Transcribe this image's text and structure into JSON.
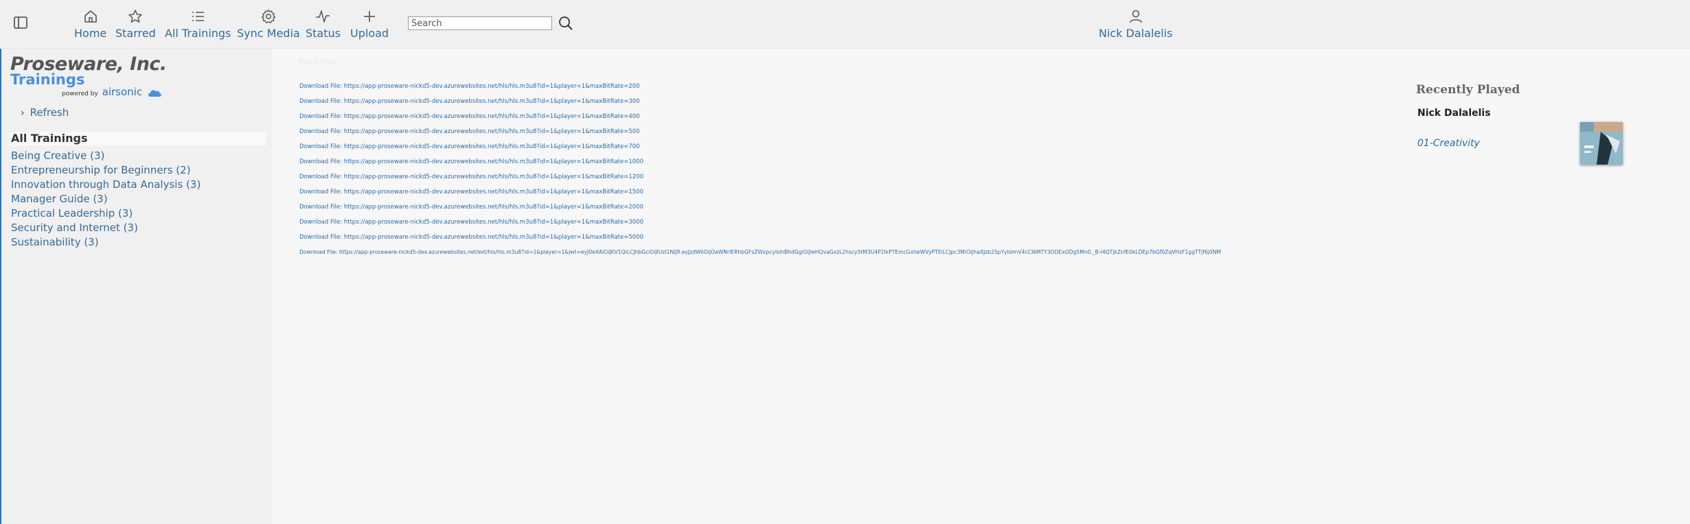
{
  "nav": {
    "items": [
      {
        "label": "Home",
        "icon": "home-icon"
      },
      {
        "label": "Starred",
        "icon": "star-icon"
      },
      {
        "label": "All Trainings",
        "icon": "list-icon"
      },
      {
        "label": "Sync Media",
        "icon": "gear-icon"
      },
      {
        "label": "Status",
        "icon": "pulse-icon"
      },
      {
        "label": "Upload",
        "icon": "plus-icon"
      }
    ],
    "search_placeholder": "Search",
    "user_name": "Nick Dalalelis"
  },
  "sidebar": {
    "logo": {
      "company": "Proseware, Inc.",
      "product": "Trainings",
      "powered_by": "powered by",
      "brand": "airsonic"
    },
    "refresh_label": "Refresh",
    "all_trainings_label": "All Trainings",
    "categories": [
      "Being Creative (3)",
      "Entrepreneurship for Beginners (2)",
      "Innovation through Data Analysis (3)",
      "Manager Guide (3)",
      "Practical Leadership (3)",
      "Security and Internet (3)",
      "Sustainability (3)"
    ]
  },
  "main": {
    "faint_title": "Media Files",
    "downloads": [
      "Download File: https://app-proseware-nickd5-dev.azurewebsites.net/hls/hls.m3u8?id=1&player=1&maxBitRate=200",
      "Download File: https://app-proseware-nickd5-dev.azurewebsites.net/hls/hls.m3u8?id=1&player=1&maxBitRate=300",
      "Download File: https://app-proseware-nickd5-dev.azurewebsites.net/hls/hls.m3u8?id=1&player=1&maxBitRate=400",
      "Download File: https://app-proseware-nickd5-dev.azurewebsites.net/hls/hls.m3u8?id=1&player=1&maxBitRate=500",
      "Download File: https://app-proseware-nickd5-dev.azurewebsites.net/hls/hls.m3u8?id=1&player=1&maxBitRate=700",
      "Download File: https://app-proseware-nickd5-dev.azurewebsites.net/hls/hls.m3u8?id=1&player=1&maxBitRate=1000",
      "Download File: https://app-proseware-nickd5-dev.azurewebsites.net/hls/hls.m3u8?id=1&player=1&maxBitRate=1200",
      "Download File: https://app-proseware-nickd5-dev.azurewebsites.net/hls/hls.m3u8?id=1&player=1&maxBitRate=1500",
      "Download File: https://app-proseware-nickd5-dev.azurewebsites.net/hls/hls.m3u8?id=1&player=1&maxBitRate=2000",
      "Download File: https://app-proseware-nickd5-dev.azurewebsites.net/hls/hls.m3u8?id=1&player=1&maxBitRate=3000",
      "Download File: https://app-proseware-nickd5-dev.azurewebsites.net/hls/hls.m3u8?id=1&player=1&maxBitRate=5000",
      "Download File: https://app-proseware-nickd5-dev.azurewebsites.net/ext/hls/hls.m3u8?id=1&player=1&jwt=eyJ0eXAiOiJKV1QiLCJhbGciOiJIUzI1NiJ9.eyJzdWIiOiJOaWNrIERhbGFsZWxpcyIsInBhdGgiOiJleHQvaGxzL2hscy5tM3U4P2lkPTEmcGxheWVyPTEiLCJpc3MiOiJhaXJzb25pYyIsImV4cCI6MTY3ODExODg5Mn0._B-I4QTjkZnfE0kLDEp7bGf0ZqVHzF1ggTTjf6j0NM"
    ]
  },
  "recent": {
    "title": "Recently Played",
    "user": "Nick Dalalelis",
    "item": "01-Creativity"
  },
  "colors": {
    "link": "#346a9a",
    "logo_blue": "#4a90d9",
    "topbar_bg": "#f0f0f0"
  }
}
